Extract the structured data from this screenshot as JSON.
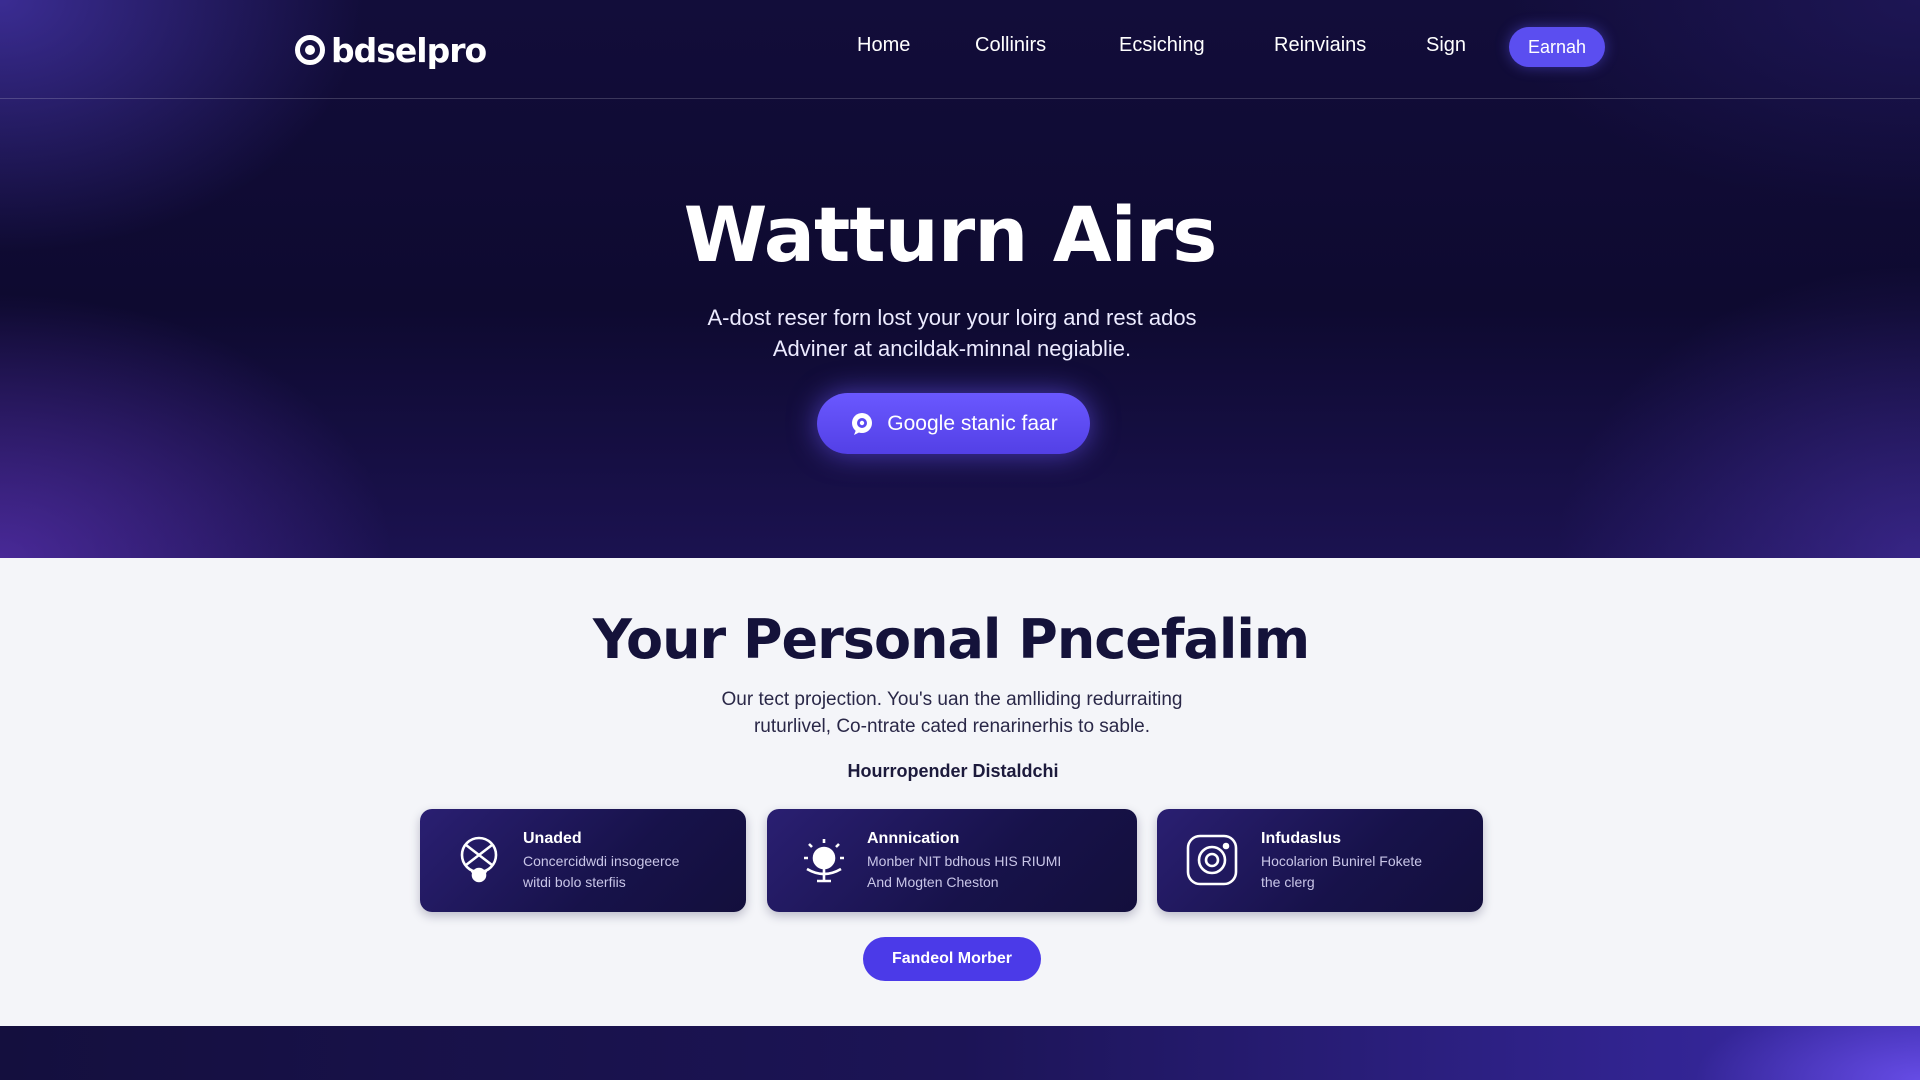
{
  "header": {
    "logo_text": "bdselpro",
    "nav": [
      "Home",
      "Collinirs",
      "Ecsiching",
      "Reinviains",
      "Sign"
    ],
    "cta_label": "Earnah"
  },
  "hero": {
    "title": "Watturn Airs",
    "subtitle_line1": "A-dost reser forn lost your your loirg and rest ados",
    "subtitle_line2": "Adviner at ancildak-minnal negiablie.",
    "button_label": "Google stanic faar",
    "button_icon": "chat-bubble-icon"
  },
  "section": {
    "title": "Your Personal Pncefalim",
    "text_line1": "Our tect projection. You's uan the amlliding redurraiting",
    "text_line2": "ruturlivel, Co-ntrate cated renarinerhis to sable.",
    "label": "Hourropender Distaldchi",
    "cards": [
      {
        "title": "Unaded",
        "desc_line1": "Concercidwdi insogeerce",
        "desc_line2": "witdi bolo sterfiis",
        "icon": "shield-compass-icon"
      },
      {
        "title": "Annnication",
        "desc_line1": "Monber NIT bdhous HIS RIUMI",
        "desc_line2": "And Mogten Cheston",
        "icon": "lightbulb-icon"
      },
      {
        "title": "Infudaslus",
        "desc_line1": "Hocolarion Bunirel Fokete",
        "desc_line2": "the clerg",
        "icon": "camera-icon"
      }
    ],
    "button_label": "Fandeol Morber"
  },
  "colors": {
    "hero_bg": "#0f0b33",
    "accent": "#5b4ef0",
    "section_bg": "#f4f5f9",
    "card_bg": "#1a1450"
  }
}
